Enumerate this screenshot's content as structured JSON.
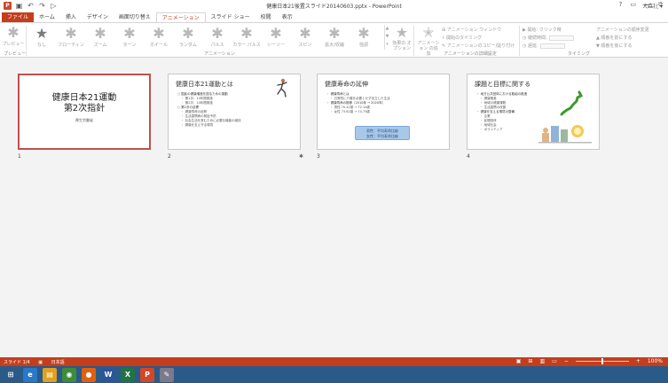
{
  "window": {
    "title": "健康日本21後置スライド20140603.pptx - PowerPoint",
    "controls": [
      "?",
      "▭",
      "—",
      "⧉"
    ]
  },
  "qat": [
    "save-icon",
    "undo-icon",
    "redo-icon",
    "present-icon"
  ],
  "tabs": [
    {
      "label": "ファイル",
      "kind": "file"
    },
    {
      "label": "ホーム"
    },
    {
      "label": "挿入"
    },
    {
      "label": "デザイン"
    },
    {
      "label": "画面切り替え"
    },
    {
      "label": "アニメーション",
      "kind": "active"
    },
    {
      "label": "スライド ショー"
    },
    {
      "label": "校閲"
    },
    {
      "label": "表示"
    }
  ],
  "user_name": "大森壮 ▾",
  "ribbon": {
    "preview_label": "プレビュー",
    "gallery": [
      {
        "label": "なし"
      },
      {
        "label": "フローティン"
      },
      {
        "label": "ズーム"
      },
      {
        "label": "ターン"
      },
      {
        "label": "ホイール"
      },
      {
        "label": "ランダム"
      },
      {
        "label": "パルス"
      },
      {
        "label": "カラー パルス"
      },
      {
        "label": "シーソー"
      },
      {
        "label": "スピン"
      },
      {
        "label": "拡大/収縮"
      },
      {
        "label": "強調"
      }
    ],
    "effect_options_label": "効果の オプション",
    "animation_group_label": "アニメーション",
    "add_animation_label": "アニメーション の追加",
    "advanced_group_label": "アニメーションの詳細設定",
    "animation_pane": "アニメーション ウィンドウ",
    "trigger": "開始のタイミング",
    "painter": "アニメーションのコピー/貼り付け",
    "timing_start": "開始:",
    "timing_start_value": "クリック時",
    "timing_duration": "継続時間:",
    "timing_delay": "遅延:",
    "reorder_title": "アニメーションの順序変更",
    "move_earlier": "▲ 順番を前にする",
    "move_later": "▼ 順番を後にする",
    "timing_group_label": "タイミング"
  },
  "slides": [
    {
      "number": "1",
      "title": "健康日本21運動\n第2次指針",
      "subtitle": "厚生労働省"
    },
    {
      "number": "2",
      "heading": "健康日本21運動とは",
      "lines": [
        {
          "t": "○ 国民の健康増進を図るための運動",
          "ind": false
        },
        {
          "t": "・ 第1次：10年間実施",
          "ind": true
        },
        {
          "t": "・ 第2次：10年間実施",
          "ind": true
        },
        {
          "t": "○ 第2次の目標",
          "ind": false
        },
        {
          "t": "・ 健康寿命の延伸",
          "ind": true
        },
        {
          "t": "・ 生活習慣病の発症予防",
          "ind": true
        },
        {
          "t": "・ 社会生活を営むために必要な機能の維持",
          "ind": true
        },
        {
          "t": "・ 健康を支え守る環境",
          "ind": true
        }
      ]
    },
    {
      "number": "3",
      "heading": "健康寿命の延伸",
      "lines": [
        {
          "t": "・ 健康寿命とは",
          "ind": false
        },
        {
          "t": "・ 日常的に介護を必要とせず自立した生活",
          "ind": true
        },
        {
          "t": "・ 健康寿命の推移（2010年 → 2020年）",
          "ind": false
        },
        {
          "t": "・ 男性 70.42歳 → 72.14歳",
          "ind": true
        },
        {
          "t": "・ 女性 73.62歳 → 74.79歳",
          "ind": true
        }
      ],
      "callout": [
        "男性：平均寿命比較",
        "女性：平均寿命比較"
      ]
    },
    {
      "number": "4",
      "heading": "課題と目標に関する",
      "lines": [
        {
          "t": "・ 地方公共団体における取組の推進",
          "ind": false
        },
        {
          "t": "・ 健康格差",
          "ind": true
        },
        {
          "t": "・ 地域の健康課題",
          "ind": true
        },
        {
          "t": "・ 生活習慣の改善",
          "ind": true
        },
        {
          "t": "・ 健康を支える環境の整備",
          "ind": false
        },
        {
          "t": "・ 企業",
          "ind": true
        },
        {
          "t": "・ 民間団体",
          "ind": true
        },
        {
          "t": "・ 地域社会",
          "ind": true
        },
        {
          "t": "・ ボランティア",
          "ind": true
        }
      ]
    }
  ],
  "status": {
    "slide": "スライド 1/4",
    "lang": "日本語",
    "zoom": "100%",
    "zoom_fraction": 0.5
  },
  "taskbar": {
    "apps": [
      {
        "name": "windows-start-icon",
        "glyph": "⊞",
        "color": "#2a5a88"
      },
      {
        "name": "ie-icon",
        "glyph": "e",
        "color": "#2a78c8"
      },
      {
        "name": "explorer-icon",
        "glyph": "▤",
        "color": "#e0a020"
      },
      {
        "name": "chrome-icon",
        "glyph": "◉",
        "color": "#3c8c3c"
      },
      {
        "name": "firefox-icon",
        "glyph": "●",
        "color": "#e06010"
      },
      {
        "name": "word-icon",
        "glyph": "W",
        "color": "#2a5699"
      },
      {
        "name": "excel-icon",
        "glyph": "X",
        "color": "#217346"
      },
      {
        "name": "powerpoint-icon",
        "glyph": "P",
        "color": "#d24726"
      },
      {
        "name": "paint-icon",
        "glyph": "✎",
        "color": "#7a7a8a"
      }
    ],
    "time": "10:52",
    "date": "2014/06/10"
  }
}
